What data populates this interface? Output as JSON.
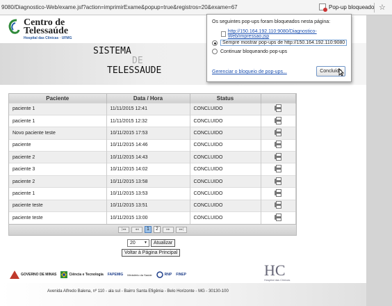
{
  "browser": {
    "url": "9080/Diagnostico-Web/exame.jsf?action=imprimirExame&popup=true&registros=20&exame=67",
    "popup_indicator_label": "Pop-up bloqueado",
    "star_icon": "☆"
  },
  "header": {
    "logo_line1": "Centro de",
    "logo_line2": "Telessaúde",
    "logo_line3": "Hospital das Clínicas · UFMG",
    "title_line1": "SISTEMA",
    "title_line2": "DE",
    "title_line3": "TELESSAUDE"
  },
  "table": {
    "columns": [
      "Paciente",
      "Data / Hora",
      "Status",
      ""
    ],
    "rows": [
      {
        "paciente": "paciente 1",
        "data": "11/11/2015 12:41",
        "status": "CONCLUIDO"
      },
      {
        "paciente": "paciente 1",
        "data": "11/11/2015 12:32",
        "status": "CONCLUIDO"
      },
      {
        "paciente": "Novo paciente teste",
        "data": "10/11/2015 17:53",
        "status": "CONCLUIDO"
      },
      {
        "paciente": "paciente",
        "data": "10/11/2015 14:46",
        "status": "CONCLUIDO"
      },
      {
        "paciente": "paciente 2",
        "data": "10/11/2015 14:43",
        "status": "CONCLUIDO"
      },
      {
        "paciente": "paciente 3",
        "data": "10/11/2015 14:02",
        "status": "CONCLUIDO"
      },
      {
        "paciente": "paciente 2",
        "data": "10/11/2015 13:58",
        "status": "CONCLUIDO"
      },
      {
        "paciente": "paciente 1",
        "data": "10/11/2015 13:53",
        "status": "CONCLUIDO"
      },
      {
        "paciente": "paciente teste",
        "data": "10/11/2015 13:51",
        "status": "CONCLUIDO"
      },
      {
        "paciente": "paciente teste",
        "data": "10/11/2015 13:00",
        "status": "CONCLUIDO"
      }
    ],
    "pager": {
      "first": "|◂◂",
      "prev": "◂◂",
      "pages": [
        "1",
        "2"
      ],
      "current_page": "1",
      "next": "▸▸",
      "last": "▸▸|"
    }
  },
  "controls": {
    "records_selected": "20",
    "update_label": "Atualizar",
    "back_label": "Voltar à Página Principal"
  },
  "footer": {
    "logos": [
      "GOVERNO DE MINAS",
      "Ciência e Tecnologia",
      "FAPEMIG",
      "Ministério da Saúde",
      "RNP",
      "FINEP"
    ],
    "hc_logo": "HC",
    "hc_sub": "Hospital das Clínicas",
    "address": "Avenida Alfredo Balena, nº 110 - ala sul  - Bairro Santa Efigênia - Belo Horizonte - MG - 30130-100"
  },
  "popup": {
    "message": "Os seguintes pop-ups foram bloqueados nesta página:",
    "blocked_link": "http://150.164.192.110:9080/Diagnostico-Web/impressao.jsp",
    "option_always": "Sempre mostrar pop-ups de http://150.164.192.110:9080",
    "option_block": "Continuar bloqueando pop-ups",
    "manage_link": "Gerenciar o bloqueio de pop-ups...",
    "done_button": "Concluído"
  }
}
